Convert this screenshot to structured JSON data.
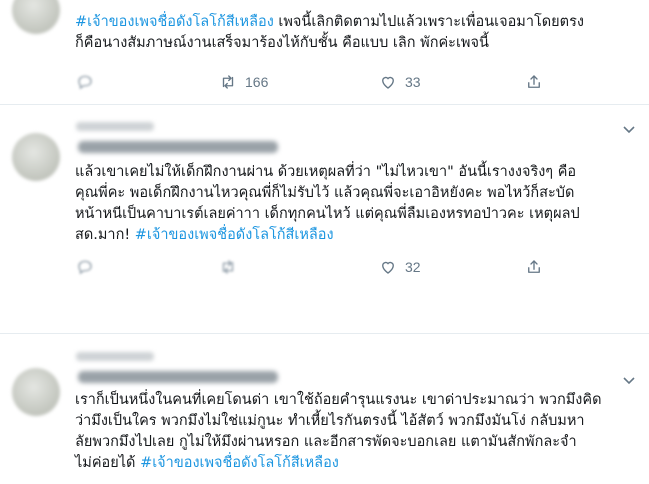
{
  "tweets": [
    {
      "lines": [
        {
          "tag": "#เจ้าของเพจชื่อดังโลโก้สีเหลือง",
          "rest": " เพจนี้เลิกติดตามไปแล้วเพราะเพื่อนเจอมาโดยตรง"
        },
        {
          "tag": "",
          "rest": "ก็คือนางสัมภาษณ์งานเสร็จมาร้องไห้กับชั้น คือแบบ เลิก พักค่ะเพจนี้"
        }
      ],
      "retweets": "166",
      "likes": "33"
    },
    {
      "lines": [
        {
          "tag": "",
          "rest": "แล้วเขาเคยไม่ให้เด็กฝึกงานผ่าน ด้วยเหตุผลที่ว่า \"ไม่ไหวเขา\" อันนี้เรางงจริงๆ คือ"
        },
        {
          "tag": "",
          "rest": "คุณพี่คะ พอเด็กฝึกงานไหวคุณพี่ก็ไม่รับไว้ แล้วคุณพี่จะเอาอิหยังคะ พอไหว้ก็สะบัด"
        },
        {
          "tag": "",
          "rest": "หน้าหนีเป็นคาบาเรต์เลยค่าาา เด็กทุกคนไหว้ แต่คุณพี่ลืมเองหรทอป่าวคะ เหตุผลป"
        },
        {
          "tag": "",
          "rest": "สด.มาก! ",
          "tag_after": "#เจ้าของเพจชื่อดังโลโก้สีเหลือง"
        }
      ],
      "likes": "32"
    },
    {
      "lines": [
        {
          "tag": "",
          "rest": "เราก็เป็นหนึ่งในคนที่เคยโดนด่า เขาใช้ถ้อยคำรุนแรงนะ เขาด่าประมาณว่า พวกมึงคิด"
        },
        {
          "tag": "",
          "rest": "ว่ามึงเป็นใคร พวกมึงไม่ใช่แม่กูนะ ทำเหี้ยไรกันตรงนี้ ไอ้สัตว์ พวกมึงมันโง่ กลับมหา"
        },
        {
          "tag": "",
          "rest": "ลัยพวกมึงไปเลย กูไม่ให้มึงผ่านหรอก และอีกสารพัดจะบอกเลย แตามันสักพักละจำ"
        },
        {
          "tag": "",
          "rest": "ไม่ค่อยได้ ",
          "tag_after": "#เจ้าของเพจชื่อดังโลโก้สีเหลือง"
        }
      ]
    }
  ],
  "colors": {
    "hashtag": "#1b95e0",
    "icon": "#657786",
    "divider": "#e6ecf0"
  }
}
